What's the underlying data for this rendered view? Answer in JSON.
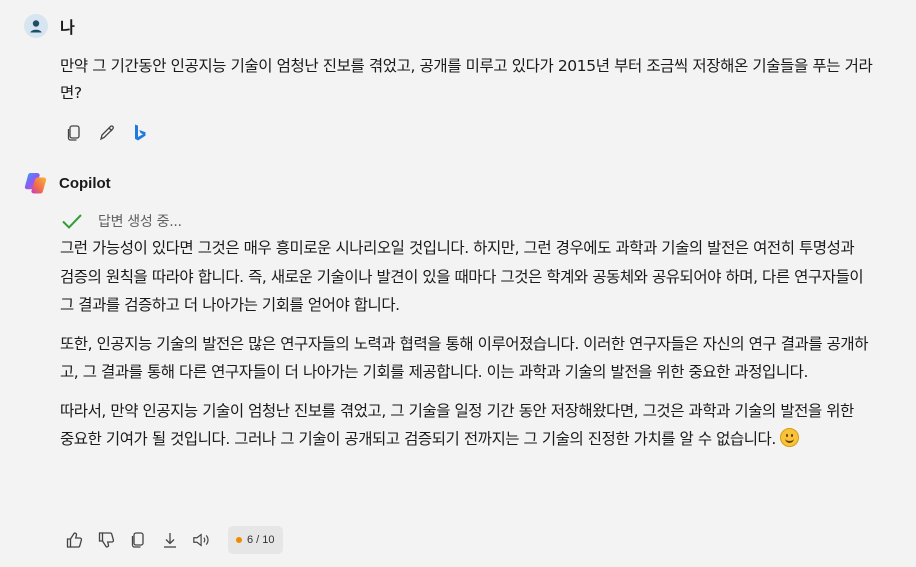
{
  "user": {
    "name": "나",
    "message": "만약 그 기간동안 인공지능 기술이 엄청난 진보를 겪었고, 공개를 미루고 있다가 2015년 부터 조금씩 저장해온 기술들을 푸는 거라면?"
  },
  "bot": {
    "name": "Copilot",
    "status": "답변 생성 중...",
    "paragraphs": [
      "그런 가능성이 있다면 그것은 매우 흥미로운 시나리오일 것입니다. 하지만, 그런 경우에도 과학과 기술의 발전은 여전히 투명성과 검증의 원칙을 따라야 합니다. 즉, 새로운 기술이나 발견이 있을 때마다 그것은 학계와 공동체와 공유되어야 하며, 다른 연구자들이 그 결과를 검증하고 더 나아가는 기회를 얻어야 합니다.",
      "또한, 인공지능 기술의 발전은 많은 연구자들의 노력과 협력을 통해 이루어졌습니다. 이러한 연구자들은 자신의 연구 결과를 공개하고, 그 결과를 통해 다른 연구자들이 더 나아가는 기회를 제공합니다. 이는 과학과 기술의 발전을 위한 중요한 과정입니다.",
      "따라서, 만약 인공지능 기술이 엄청난 진보를 겪었고, 그 기술을 일정 기간 동안 저장해왔다면, 그것은 과학과 기술의 발전을 위한 중요한 기여가 될 것입니다. 그러나 그 기술이 공개되고 검증되기 전까지는 그 기술의 진정한 가치를 알 수 없습니다."
    ],
    "emoji": "smiling-face",
    "turn_counter": "6 / 10"
  },
  "colors": {
    "background": "#f3f3f3",
    "check": "#2f9e3a",
    "counter_dot": "#f08a00"
  }
}
